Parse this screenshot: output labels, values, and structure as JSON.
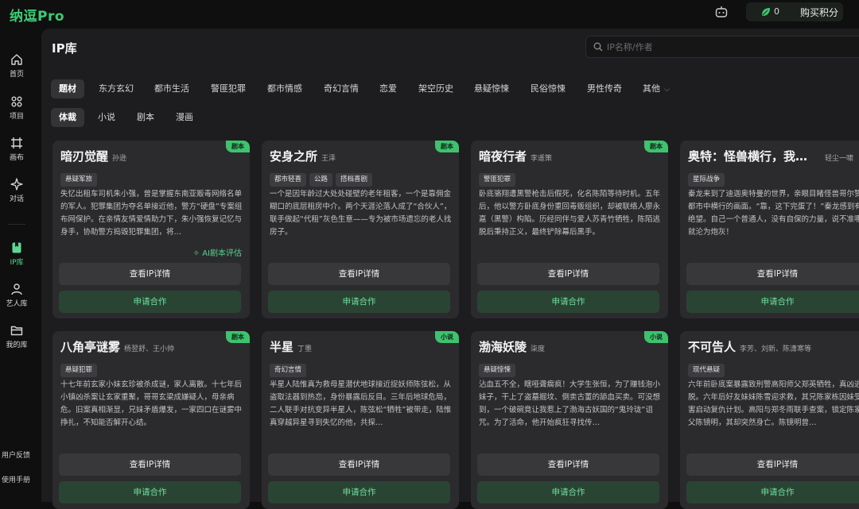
{
  "app": {
    "logo": "纳逗Pro"
  },
  "header": {
    "credits": "0",
    "buy_credits": "购买积分"
  },
  "sidebar": {
    "items": [
      {
        "label": "首页",
        "icon": "home-icon"
      },
      {
        "label": "项目",
        "icon": "grid-icon"
      },
      {
        "label": "画布",
        "icon": "canvas-icon"
      },
      {
        "label": "对话",
        "icon": "sparkle-icon"
      },
      {
        "label": "IP库",
        "icon": "bookmark-icon"
      },
      {
        "label": "艺人库",
        "icon": "user-icon"
      },
      {
        "label": "我的库",
        "icon": "folder-icon"
      }
    ],
    "footer": [
      "用户反馈",
      "使用手册"
    ]
  },
  "page": {
    "title": "IP库"
  },
  "search": {
    "placeholder": "IP名称/作者"
  },
  "genres": [
    "题材",
    "东方玄幻",
    "都市生活",
    "警匪犯罪",
    "都市情感",
    "奇幻言情",
    "恋爱",
    "架空历史",
    "悬疑惊悚",
    "民俗惊悚",
    "男性传奇",
    "其他"
  ],
  "formats": [
    "体裁",
    "小说",
    "剧本",
    "漫画"
  ],
  "colors": {
    "accent": "#3ecb73",
    "badge": "#3ec26e",
    "apply_bg": "#2a4434"
  },
  "cards": [
    {
      "title": "暗刃觉醒",
      "author": "孙逊",
      "badge": "剧本",
      "tags": [
        "悬疑军旅"
      ],
      "desc": "失忆出租车司机朱小强，曾是掌握东南亚贩毒网络名单的军人。犯罪集团为夺名单接近他，警方“硬盘”专案组布网保护。在亲情友情爱情助力下，朱小强恢复记忆与身手，协助警方捣毁犯罪集团，将…",
      "ai": "✧ AI剧本评估",
      "detail": "查看IP详情",
      "apply": "申请合作"
    },
    {
      "title": "安身之所",
      "author": "王泽",
      "badge": "剧本",
      "tags": [
        "都市轻喜",
        "公路",
        "搭档喜剧"
      ],
      "desc": "一个是因年龄过大处处碰壁的老年租客，一个是靠佣金糊口的底层租房中介。两个天涯沦落人成了“合伙人”，联手做起“代租”灰色生意——专为被市场遗忘的老人找房子。",
      "detail": "查看IP详情",
      "apply": "申请合作"
    },
    {
      "title": "暗夜行者",
      "author": "李遥策",
      "badge": "剧本",
      "tags": [
        "警匪犯罪"
      ],
      "desc": "卧底骆翔遭黑警枪击后假死，化名陈陌等待时机。五年后，他以警方卧底身份重回毒贩组织，却被联络人廖永嘉（黑警）构陷。历经同伴与爱人苏青竹牺牲，陈陌逃脱后秉持正义，最终铲除幕后黑手。",
      "detail": "查看IP详情",
      "apply": "申请合作"
    },
    {
      "title": "奥特：怪兽横行，我…",
      "author": "轻尘一啸",
      "badge": "",
      "tags": [
        "星际战争"
      ],
      "desc": "秦龙来到了迪迦奥特曼的世界，亲眼目睹怪兽哥尔赞于都市中横行的画面。“靠，这下完蛋了！”秦龙感到有些绝望。自己一个普通人，没有自保的力量，说不准哪天就沦为炮灰！",
      "detail": "查看IP详情",
      "apply": "申请合作"
    },
    {
      "title": "八角亭谜雾",
      "author": "杨翌舒、王小帅",
      "badge": "剧本",
      "tags": [
        "悬疑犯罪"
      ],
      "desc": "十七年前玄家小妹玄珍被杀成谜，家人离散。十七年后小镇凶杀案让玄家重聚，哥哥玄梁成嫌疑人，母亲病危。旧案真相渐显，兄妹矛盾爆发，一家四口在谜雾中挣扎，不知能否解开心结。",
      "detail": "查看IP详情",
      "apply": "申请合作"
    },
    {
      "title": "半星",
      "author": "丁墨",
      "badge": "小说",
      "tags": [
        "奇幻言情"
      ],
      "desc": "半星人陆惟真为救母星潜伏地球接近捉妖师陈弦松，从盗取法器到热恋，身份暴露后反目。三年后地球危局，二人联手对抗变异半星人，陈弦松“牺牲”被带走，陆惟真穿越异星寻到失忆的他，共探…",
      "detail": "查看IP详情",
      "apply": "申请合作"
    },
    {
      "title": "渤海妖陵",
      "author": "柒度",
      "badge": "小说",
      "tags": [
        "悬疑惊悚"
      ],
      "desc": "沾血五不全，瞎哑聋瘸疯！大学生张恒，为了赚钱泡小妹子，干上了盗墓掘坟、倒卖古董的舔血买卖。可没想到，一个破碗竟让我惹上了渤海古妖国的“鬼玲珑”诅咒。为了活命，他开始疯狂寻找传…",
      "detail": "查看IP详情",
      "apply": "申请合作"
    },
    {
      "title": "不可告人",
      "author": "李芳、刘新、陈潇寒等",
      "badge": "",
      "tags": [
        "现代悬疑"
      ],
      "desc": "六年前卧底案暴露致刑警高阳师父郑英牺牲，真凶逃脱。六年后好友妹妹陈雪迎求救，其兄陈家栋因妹受伤害启动复仇计划。高阳与郑冬雨联手查案，锁定陈家栋父陈镜明，其却突然身亡。陈镜明曾…",
      "detail": "查看IP详情",
      "apply": "申请合作"
    }
  ]
}
